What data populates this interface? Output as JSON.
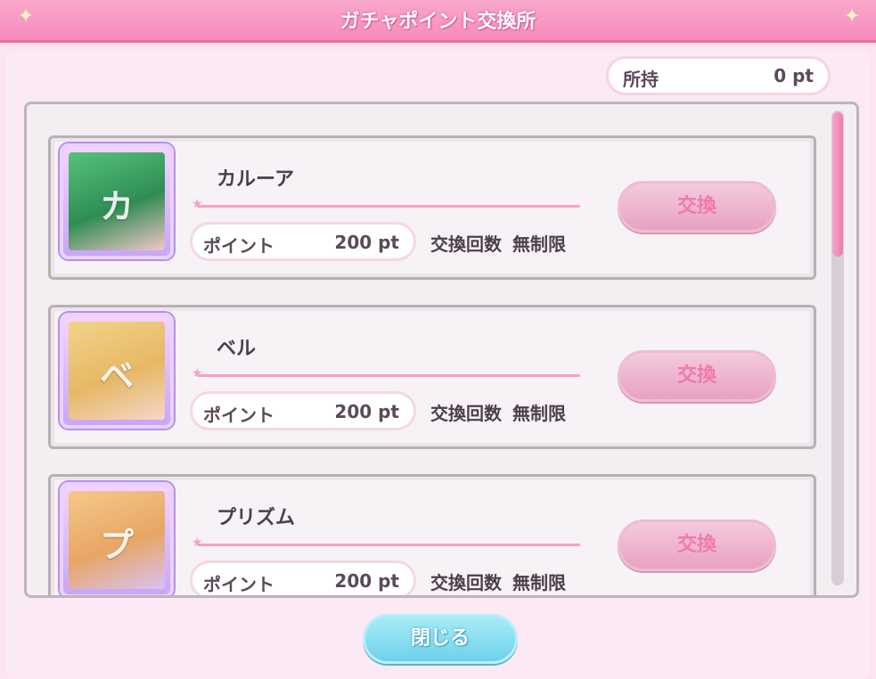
{
  "header": {
    "title": "ガチャポイント交換所"
  },
  "owned": {
    "label": "所持",
    "value": "0 pt"
  },
  "items": [
    {
      "name": "カルーア",
      "initial": "カ",
      "point_label": "ポイント",
      "points": "200 pt",
      "count_label": "交換回数",
      "count_value": "無制限",
      "button": "交換",
      "color": "#56c27d"
    },
    {
      "name": "ベル",
      "initial": "ベ",
      "point_label": "ポイント",
      "points": "200 pt",
      "count_label": "交換回数",
      "count_value": "無制限",
      "button": "交換",
      "color": "#f2d38a"
    },
    {
      "name": "プリズム",
      "initial": "プ",
      "point_label": "ポイント",
      "points": "200 pt",
      "count_label": "交換回数",
      "count_value": "無制限",
      "button": "交換",
      "color": "#f5c98a"
    }
  ],
  "footer": {
    "close_label": "閉じる"
  },
  "colors": {
    "accent": "#f78bbc",
    "button_disabled": "#e8a2c2",
    "close_button": "#6dd1ea"
  }
}
